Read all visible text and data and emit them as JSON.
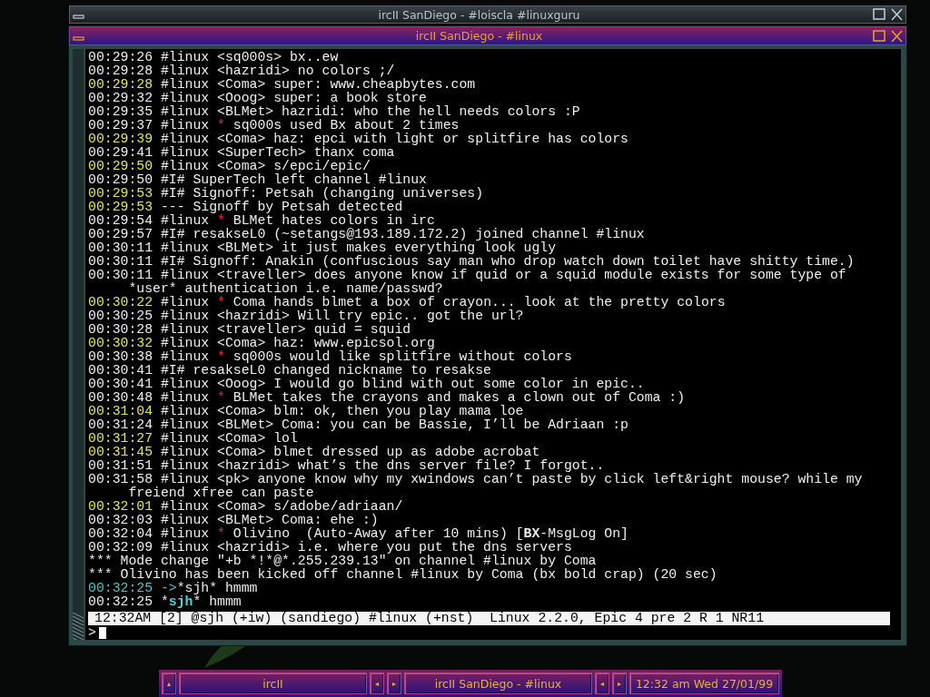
{
  "back_window": {
    "title": "ircII SanDiego - #loiscla #linuxguru"
  },
  "window": {
    "title": "ircII SanDiego - #linux"
  },
  "log": [
    {
      "time": "00:29:26",
      "color": "#eeeeee",
      "parts": [
        {
          "kind": "text",
          "text": "#linux <sq000s> bx..ew"
        }
      ]
    },
    {
      "time": "00:29:28",
      "color": "#eeeeee",
      "parts": [
        {
          "kind": "text",
          "text": "#linux <hazridi> no colors ;/"
        }
      ]
    },
    {
      "time": "00:29:28",
      "color": "#e6e640",
      "parts": [
        {
          "kind": "text",
          "text": "#linux <Coma> super: www.cheapbytes.com"
        }
      ]
    },
    {
      "time": "00:29:32",
      "color": "#eeeeee",
      "parts": [
        {
          "kind": "text",
          "text": "#linux <Ooog> super: a book store"
        }
      ]
    },
    {
      "time": "00:29:35",
      "color": "#eeeeee",
      "parts": [
        {
          "kind": "text",
          "text": "#linux <BLMet> hazridi: who the hell needs colors :P"
        }
      ]
    },
    {
      "time": "00:29:37",
      "color": "#eeeeee",
      "parts": [
        {
          "kind": "text",
          "text": "#linux "
        },
        {
          "kind": "star",
          "text": "*"
        },
        {
          "kind": "text",
          "text": " sq000s used Bx about 2 times"
        }
      ]
    },
    {
      "time": "00:29:39",
      "color": "#e6e640",
      "parts": [
        {
          "kind": "text",
          "text": "#linux <Coma> haz: epci with light or splitfire has colors"
        }
      ]
    },
    {
      "time": "00:29:41",
      "color": "#eeeeee",
      "parts": [
        {
          "kind": "text",
          "text": "#linux <SuperTech> thanx coma"
        }
      ]
    },
    {
      "time": "00:29:50",
      "color": "#e6e640",
      "parts": [
        {
          "kind": "text",
          "text": "#linux <Coma> s/epci/epic/"
        }
      ]
    },
    {
      "time": "00:29:50",
      "color": "#eeeeee",
      "parts": [
        {
          "kind": "text",
          "text": "#I# SuperTech left channel #linux"
        }
      ]
    },
    {
      "time": "00:29:53",
      "color": "#e6e640",
      "parts": [
        {
          "kind": "text",
          "text": "#I# Signoff: Petsah (changing universes)"
        }
      ]
    },
    {
      "time": "00:29:53",
      "color": "#e6e640",
      "parts": [
        {
          "kind": "text",
          "text": "--- Signoff by Petsah detected"
        }
      ]
    },
    {
      "time": "00:29:54",
      "color": "#eeeeee",
      "parts": [
        {
          "kind": "text",
          "text": "#linux "
        },
        {
          "kind": "star",
          "text": "*"
        },
        {
          "kind": "text",
          "text": " BLMet hates colors in irc"
        }
      ]
    },
    {
      "time": "00:29:57",
      "color": "#eeeeee",
      "parts": [
        {
          "kind": "text",
          "text": "#I# resakseL0 (~setangs@193.189.172.2) joined channel #linux"
        }
      ]
    },
    {
      "time": "00:30:11",
      "color": "#eeeeee",
      "parts": [
        {
          "kind": "text",
          "text": "#linux <BLMet> it just makes everything look ugly"
        }
      ]
    },
    {
      "time": "00:30:11",
      "color": "#eeeeee",
      "parts": [
        {
          "kind": "text",
          "text": "#I# Signoff: Anakin (confuscious say man who drop watch down toilet have shitty time.)"
        }
      ]
    },
    {
      "time": "00:30:11",
      "color": "#eeeeee",
      "parts": [
        {
          "kind": "text",
          "text": "#linux <traveller> does anyone know if quid or a squid module exists for some type of"
        }
      ],
      "wrap": "*user* authentication i.e. name/passwd?"
    },
    {
      "time": "00:30:22",
      "color": "#e6e640",
      "parts": [
        {
          "kind": "text",
          "text": "#linux "
        },
        {
          "kind": "star",
          "text": "*"
        },
        {
          "kind": "text",
          "text": " Coma hands blmet a box of crayon... look at the pretty colors"
        }
      ]
    },
    {
      "time": "00:30:25",
      "color": "#eeeeee",
      "parts": [
        {
          "kind": "text",
          "text": "#linux <hazridi> Will try epic.. got the url?"
        }
      ]
    },
    {
      "time": "00:30:28",
      "color": "#eeeeee",
      "parts": [
        {
          "kind": "text",
          "text": "#linux <traveller> quid = squid"
        }
      ]
    },
    {
      "time": "00:30:32",
      "color": "#e6e640",
      "parts": [
        {
          "kind": "text",
          "text": "#linux <Coma> haz: www.epicsol.org"
        }
      ]
    },
    {
      "time": "00:30:38",
      "color": "#eeeeee",
      "parts": [
        {
          "kind": "text",
          "text": "#linux "
        },
        {
          "kind": "star",
          "text": "*"
        },
        {
          "kind": "text",
          "text": " sq000s would like splitfire without colors"
        }
      ]
    },
    {
      "time": "00:30:41",
      "color": "#eeeeee",
      "parts": [
        {
          "kind": "text",
          "text": "#I# resakseL0 changed nickname to resakse"
        }
      ]
    },
    {
      "time": "00:30:41",
      "color": "#eeeeee",
      "parts": [
        {
          "kind": "text",
          "text": "#linux <Ooog> I would go blind with out some color in epic.."
        }
      ]
    },
    {
      "time": "00:30:48",
      "color": "#eeeeee",
      "parts": [
        {
          "kind": "text",
          "text": "#linux "
        },
        {
          "kind": "star",
          "text": "*"
        },
        {
          "kind": "text",
          "text": " BLMet takes the crayons and makes a clown out of Coma :)"
        }
      ]
    },
    {
      "time": "00:31:04",
      "color": "#e6e640",
      "parts": [
        {
          "kind": "text",
          "text": "#linux <Coma> blm: ok, then you play mama loe"
        }
      ]
    },
    {
      "time": "00:31:24",
      "color": "#eeeeee",
      "parts": [
        {
          "kind": "text",
          "text": "#linux <BLMet> Coma: you can be Bassie, I’ll be Adriaan :p"
        }
      ]
    },
    {
      "time": "00:31:27",
      "color": "#e6e640",
      "parts": [
        {
          "kind": "text",
          "text": "#linux <Coma> lol"
        }
      ]
    },
    {
      "time": "00:31:45",
      "color": "#e6e640",
      "parts": [
        {
          "kind": "text",
          "text": "#linux <Coma> blmet dressed up as adobe acrobat"
        }
      ]
    },
    {
      "time": "00:31:51",
      "color": "#eeeeee",
      "parts": [
        {
          "kind": "text",
          "text": "#linux <hazridi> what’s the dns server file? I forgot.."
        }
      ]
    },
    {
      "time": "00:31:58",
      "color": "#eeeeee",
      "parts": [
        {
          "kind": "text",
          "text": "#linux <pk> anyone know why my xwindows can’t paste by click left&right mouse? while my"
        }
      ],
      "wrap": "freiend xfree can paste"
    },
    {
      "time": "00:32:01",
      "color": "#e6e640",
      "parts": [
        {
          "kind": "text",
          "text": "#linux <Coma> s/adobe/adriaan/"
        }
      ]
    },
    {
      "time": "00:32:03",
      "color": "#eeeeee",
      "parts": [
        {
          "kind": "text",
          "text": "#linux <BLMet> Coma: ehe :)"
        }
      ]
    },
    {
      "time": "00:32:04",
      "color": "#eeeeee",
      "parts": [
        {
          "kind": "text",
          "text": "#linux "
        },
        {
          "kind": "star",
          "text": "*"
        },
        {
          "kind": "rich",
          "text": " Olivino  (Auto-Away after 10 mins) [**BX**-MsgLog On]"
        }
      ]
    },
    {
      "time": "00:32:09",
      "color": "#eeeeee",
      "parts": [
        {
          "kind": "text",
          "text": "#linux <hazridi> i.e. where you put the dns servers"
        }
      ]
    },
    {
      "parts": [
        {
          "kind": "text",
          "text": "*** Mode change \"+b *!*@*.255.239.13\" on channel #linux by Coma"
        }
      ]
    },
    {
      "parts": [
        {
          "kind": "text",
          "text": "*** Olivino has been kicked off channel #linux by Coma (bx bold crap) (20 sec)"
        }
      ]
    },
    {
      "time": "00:32:25",
      "color": "#40c8c8",
      "parts": [
        {
          "kind": "arrow",
          "text": "->"
        },
        {
          "kind": "text",
          "text": "*sjh* hmmm"
        }
      ]
    },
    {
      "time": "00:32:25",
      "color": "#eeeeee",
      "parts": [
        {
          "kind": "text",
          "text": "*"
        },
        {
          "kind": "nick",
          "text": "sjh"
        },
        {
          "kind": "text",
          "text": "* hmmm"
        }
      ]
    }
  ],
  "status_bar": "12:32AM [2] @sjh (+iw) (sandiego) #linux (+nst)  Linux 2.2.0, Epic 4 pre 2 R 1 NR11",
  "input": {
    "prompt": ">"
  },
  "taskbar": {
    "items": [
      {
        "kind": "arrow",
        "label": "▴"
      },
      {
        "kind": "task",
        "label": "ircII"
      },
      {
        "kind": "arrow",
        "label": "◂"
      },
      {
        "kind": "arrow",
        "label": "▸"
      },
      {
        "kind": "task",
        "label": "ircII SanDiego - #linux"
      },
      {
        "kind": "arrow",
        "label": "◂"
      },
      {
        "kind": "arrow",
        "label": "▸"
      },
      {
        "kind": "clock",
        "label": "12:32 am Wed 27/01/99"
      }
    ]
  }
}
